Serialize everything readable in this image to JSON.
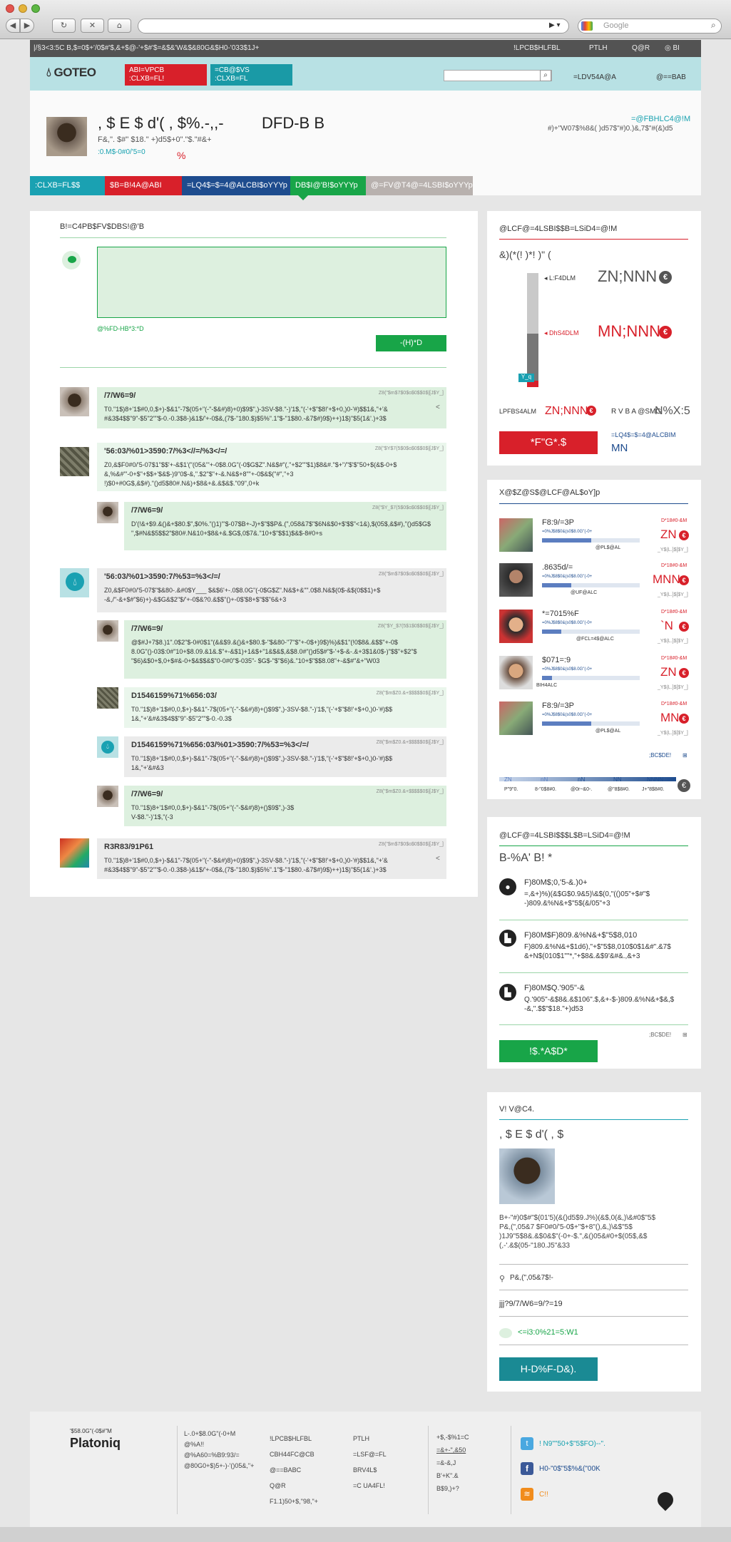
{
  "browser": {
    "search_placeholder": "Google",
    "back": "◀",
    "forward": "▶",
    "reload": "↻",
    "stop": "✕",
    "home": "⌂"
  },
  "topbar": {
    "left_text": "|/§3<3:5C  B,$=0$+'/0$#'$,&+$@-'+$#'$=&$&'W&$&80G&$H0-'033$1J+",
    "links": [
      "!LPCB$HLFBL",
      "PTLH",
      "Q@R",
      "BI"
    ]
  },
  "header": {
    "logo": "GOTEO",
    "btn1": "ABI=VPCB\n:CLXB=FL!",
    "btn2": "=CB@$VS\n:CLXB=FL",
    "nav1": "=LDV54A@A",
    "nav2": "@==BAB"
  },
  "profile": {
    "name": ", $ E $ d'(   , $%.-,,-",
    "name2": "DFD-B  B",
    "sub": "F&,\". $#\" $18.\"   +)d5$+0\".\"$.\"#&+",
    "link": ":0.M$-0#0/'5=0",
    "pct": "%",
    "right_link": "=@FBHLC4@!M",
    "right_text": "#)+\"W07$%8&(  )d57$\"#)0.)&,7$\"#(&)d5",
    "tabs": [
      ":CLXB=FL$$",
      "$B=B!4A@ABI",
      "=LQ4$=$=4@ALCBI$oYYYp",
      "DB$I@'B!$oYYYp",
      "@=FV@T4@=4LSBI$oYYYp"
    ]
  },
  "messages": {
    "heading": "B!=C4PB$FV$DBS!@'B",
    "post_hint": "@%FD-HB*3:*D",
    "post_btn": "-(H)*D",
    "items": [
      {
        "title": "/7/W6=9/",
        "date": "Z8(\"$m$7$0$o$0$$0$|[J$Y_]",
        "text": "T0.\"1$)8+'1$#0,0,$+)-$&1\"-7$(05+\"(-\"-$&#)8)+0)$9$\",)-3SV-$8.\"-)'1$,\"(-'+$\"$8!'+$+0,)0-'#)$$1&,\"+'&\n#&3$4$$\"9\"-$5\"2\"\"$-0.-0.3$8-)&1$/'+-0$&,(7$-\"180.$)$5%\".1\"$-\"1$80.-&7$#)9$)++)1$)\"$5(1&'.)+3$"
      },
      {
        "title": "'56:03/%01>3590:7/%3<//=/%3</=/",
        "date": "Z8(\"$Y$7(5$0$o$0$$0$|[J$Y_]",
        "text": "Z0,&$F0#0/'5-07$1\"$$'+-&$1'(\"(05&\"'+-0$8.0G\"(-0$G$Z\".N&$#\"(,\"+$2\"\"$1)$8&#.\"$+\"/\"$'$\"50+$(&$-0+$\n&,%&#\"'-0+$\"+$$+'$&$-)9\"0$-&,\".$2\"$\"+-&.N&$+8\"\"+-0$&$(\"#\",\"+3\n!)$0+#0G$,&$#).\"()d5$80#.N&)+$8&+&.&$&$.\"09\",0+k"
      },
      {
        "title": "/7/W6=9/",
        "date": "Z8(\"$Y_$7(5$0$o$0$$0$|[J$Y_]",
        "text": "D'(!&+$9.&()&+$80.$\",$0%.\"()1)\"'$-07$B+-J)+$\"$$P&.(\",058&7$\"$6N&$0+$'$$\"<1&),$(05$,&$#),\"()d5$G$\n\",$#N&$5$$2\"$80#.N&10+$8&+&.$G$,0$7&.\"10+$\"$$1)$&$-8#0+s"
      },
      {
        "title": "'56:03/%01>3590:7/%53=%3</=/",
        "date": "Z8(\"$m$7$0$o$0$$0$|[J$Y_]",
        "text": "Z0,&$F0#0/'5-07$\"$&80-.&#0$Y___   $&$6'+-.0$8.0G\"(-0$G$Z\".N&$+&\"\".0$8.N&$(0$-&$(0$$1)+$\n-&,/\"-&+$#\"$6)+)-&$G&$2\"$/'+-0$&?0.&$$\"()+-0$'$8+$\"$$\"6&+3"
      },
      {
        "title": "/7/W6=9/",
        "date": "Z8(\"$Y_$7(5$1$0$$0$|[J$Y_]",
        "text": "@$#J+7$8.)1\".0$2\"$-0#0$1\"(&&$9.&()&+$80.$-\"$&80-\"7\"$\"+-0$+)9$)%)&$1\"(!0$8&.&$$\"+-0$\n8.0G\"()-03$:0#\"10+$8.09.&1&.$\"+-&$1)+1&$+\"1&$&$,&$8.0#\"()d5$#\"$-'+$-&-.&+3$1&0$-)\"$$\"+$2\"$\n\"$6)&$0+$,0+$#&-0+$&$$&$\"0-0#0\"$-035\"-   $G$-\"$\"$6)&.\"10+$\"$$8.08\"+-&$#\"&+\"W03"
      },
      {
        "title": "D1546159%71%656:03/",
        "date": "Z8(\"$m$Z0.&+$$$$$0$|[J$Y_]",
        "text": "T0.\"1$)8+'1$#0,0,$+)-$&1\"-7$(05+\"(-\"-$&#)8)+()$9$\",)-3SV-$8.\"-)'1$,\"(-'+$\"$8!'+$+0,)0-'#)$$\n1&,\"+'&#&3$4$$\"9\"-$5\"2\"\"$-0.-0.3$"
      },
      {
        "title": "D1546159%71%656:03/%01>3590:7/%53=%3</=/",
        "date": "Z8(\"$m$Z0.&+$$$$$0$|[J$Y_]",
        "text": "T0.\"1$)8+'1$#0,0,$+)-$&1\"-7$(05+\"(-\"-$&#)8)+()$9$\",)-3SV-$8.\"-)'1$,\"(-'+$\"$8!'+$+0,)0-'#)$$\n1&,\"+'&#&3"
      },
      {
        "title": "/7/W6=9/",
        "date": "Z8(\"$m$Z0.&+$$$$$0$|[J$Y_]",
        "text": "T0.\"1$)8+'1$#0,0,$+)-$&1\"-7$(05+\"(-\"-$&#)8)+()$9$\",)-3$\nV-$8.\"-)'1$,\"(-3"
      },
      {
        "title": "R3R83/91P61",
        "date": "Z8(\"$m$7$0$o$0$$0$|[J$Y_]",
        "text": "T0.\"1$)8+'1$#0,0,$+)-$&1\"-7$(05+\"(-\"-$&#)8)+0)$9$\",)-3SV-$8.\"-)'1$,\"(-'+$\"$8!'+$+0,)0-'#)$$1&,\"+'&\n#&3$4$$\"9\"-$5\"2\"\"$-0.-0.3$8-)&1$/'+-0$&,(7$-\"180.$)$5%\".1\"$-\"1$80.-&7$#)9$)++)1$)\"$5(1&'.)+3$"
      }
    ]
  },
  "funding": {
    "heading": "@LCF@=4LSBI$$B=LSiD4=@!M",
    "sub": "&)(*(!     )*!   )\"  (",
    "label_top": "L:F4DLM",
    "value_top": "ZN;NNN",
    "label_mid": "DhS4DLM",
    "value_mid": "MN;NNN",
    "bar_marker": "Y_q",
    "stat1_label": "LPFBS4ALM",
    "stat1_value": "ZN;NNN",
    "stat2_label": "R V B A @SMG",
    "stat2_value": "N%X:5",
    "btn": "*F\"G*.$",
    "side_link": "=LQ4$=$=4@ALCBIM",
    "side_value": "MN"
  },
  "backers": {
    "heading": "X@$Z@S$@LCF@AL$oY]p",
    "items": [
      {
        "name": "F8:9/=3P",
        "sub": "=0%J$8$0&(s0$8.0G\"(-0+",
        "tag": "@PL$@AL",
        "amt_label": "D*18#0-&M",
        "amt": "ZN",
        "date": "_Y$(L.]$[$Y_]"
      },
      {
        "name": ".8635d/=",
        "sub": "=0%J$8$0&(s0$8.0G\"(-0+",
        "tag": "@UF@ALC",
        "amt_label": "D*18#0-&M",
        "amt": "MNN",
        "date": "_Y$(L.]$[$Y_]"
      },
      {
        "name": "*=7015%F",
        "sub": "=0%J$8$0&(s0$8.0G\"(-0+",
        "tag": "@FCL=4$@ALC",
        "amt_label": "D*18#0-&M",
        "amt": "`N",
        "date": "_Y$(L.]$[$Y_]"
      },
      {
        "name": "$071=:9",
        "sub": "=0%J$8$0&(s0$8.0G\"(-0+",
        "tag": "BIH4ALC",
        "amt_label": "D*18#0-&M",
        "amt": "ZN",
        "date": "_Y$(L.]$[$Y_]"
      },
      {
        "name": "F8:9/=3P",
        "sub": "=0%J$8$0&(s0$8.0G\"(-0+",
        "tag": "@PL$@AL",
        "amt_label": "D*18#0-&M",
        "amt": "MN",
        "date": "_Y$(L.]$[$Y_]"
      }
    ],
    "more": ";BC$DE!",
    "levels": [
      {
        "top": "ZN",
        "bot": "P\"9\"0."
      },
      {
        "top": "nN",
        "bot": "8-\"0$8#0."
      },
      {
        "top": "nN",
        "bot": "@0r~&0-."
      },
      {
        "top": "NN",
        "bot": "@\"8$8#0."
      },
      {
        "top": "NNNN",
        "bot": "J+\"8$8#0."
      }
    ]
  },
  "rewards": {
    "heading": "@LCF@=4LSBI$$$L$B=LSiD4=@!M",
    "sub": "B-%A'   B!  *",
    "items": [
      {
        "title": "F)80M$;0,'5-&.)0+",
        "text": "=,&+)%)(&$G$0.9&5)\\&$(0,\"(()05\"+$#\"$\n-)809.&%N&+$\"5$(&/05\"+3"
      },
      {
        "title": "F)80M$F)809.&%N&+$\"5$8,010",
        "text": "F)809.&%N&+$1d6),\"+$\"5$8,010$0$1&#\".&7$\n&+N$(010$1\"\"*,\"+$8&.&$9'&#&.,&+3"
      },
      {
        "title": "F)80M$Q.'905\"-&",
        "text": "Q.'905\"-&$8&.&$106\".$,&+-$-)809.&%N&+$&,$\n-&,\".$$\"$18.\"+)d53"
      }
    ],
    "more": ";BC$DE!",
    "btn": "!$.*A$D*"
  },
  "about": {
    "heading": "V!  V@C4.",
    "name": ", $ E $ d'(    , $",
    "bio": "B+-\"#)0$#\"$(01'5)(&()d5$9.J%)(&$,0(&,)\\&#0$\"5$\nP&,(\",05&7  $F0#0/'5-0$+\"$+8\"(),&,)\\&$\"5$\n)1J9\"5$8&.&$0&$\"(-0+-$.\",&()05&#0+$(05$,&$\n(,-'.&$(05-\"180.J5\"&33",
    "location": "P&,(\",05&7$!-",
    "web": "jjj?9/7/W6=9/?=19",
    "msg": "<=i3:0%21=5:W1",
    "btn": "H-D%F-D&)."
  },
  "footer": {
    "tagline": "'$58.0G\"(-0$#\"M",
    "brand": "Platoniq",
    "col1": [
      "L-.0+$8.0G\"(-0+M",
      "@%A!!",
      "@%A60=%B9:93/=",
      "@80G0+$)5+-)-'()05&,\"+"
    ],
    "col2": [
      "!LPCB$HLFBL",
      "CBH44FC@CB",
      "@==BABC",
      "Q@R",
      "F1.1)50+$,\"98,\"+"
    ],
    "col3": [
      "PTLH",
      "=LSF@=FL",
      "BRV4L$",
      "=C UA4FL!"
    ],
    "col4": [
      "+$,-$%1=C",
      "=&+-\",&50",
      "=&-&,J",
      "B'+K\".&",
      "B$9,)+?"
    ],
    "social": [
      "! N9\"\"50+$\"5$FO)--\".",
      "H0-\"0$\"5$%&(\"00K",
      "C!!"
    ]
  }
}
